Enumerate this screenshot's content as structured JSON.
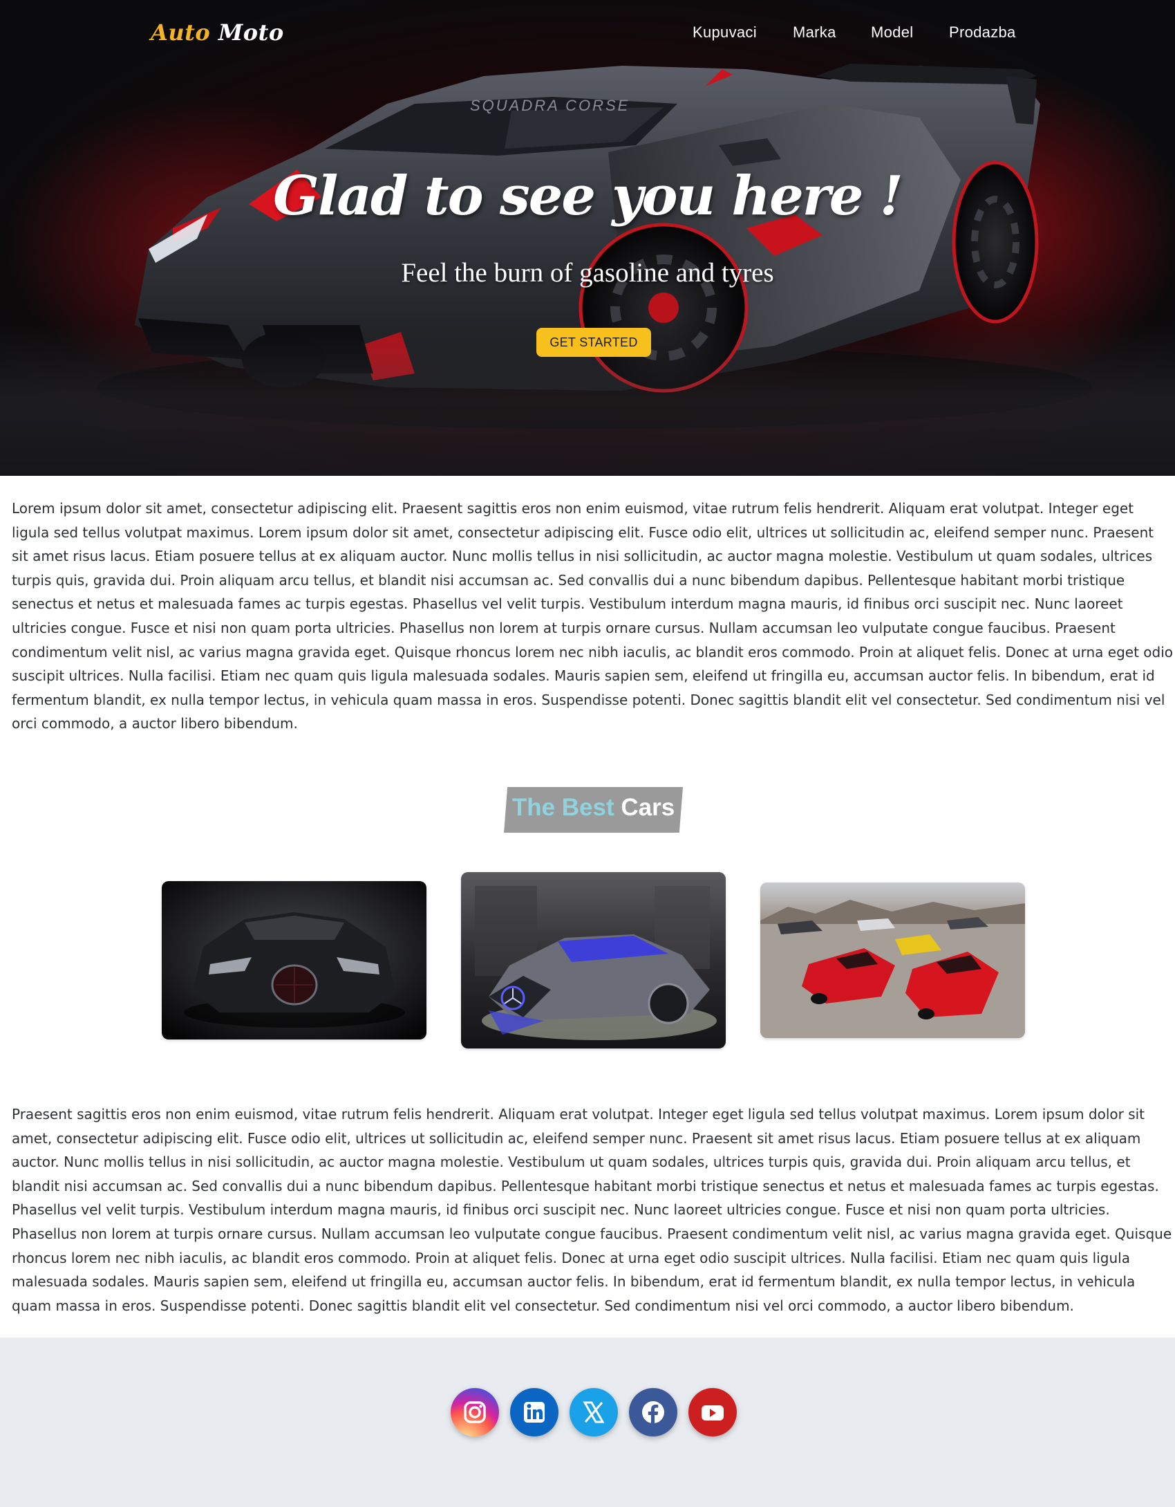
{
  "brand": {
    "part1": "Auto",
    "part2": "Moto"
  },
  "nav": {
    "items": [
      {
        "label": "Kupuvaci"
      },
      {
        "label": "Marka"
      },
      {
        "label": "Model"
      },
      {
        "label": "Prodazba"
      }
    ]
  },
  "hero": {
    "title": "Glad to see you here !",
    "subtitle": "Feel the burn of gasoline and tyres",
    "cta_label": "GET STARTED",
    "car_lettering": "SQUADRA CORSE"
  },
  "intro_text": "Lorem ipsum dolor sit amet, consectetur adipiscing elit. Praesent sagittis eros non enim euismod, vitae rutrum felis hendrerit. Aliquam erat volutpat. Integer eget ligula sed tellus volutpat maximus. Lorem ipsum dolor sit amet, consectetur adipiscing elit. Fusce odio elit, ultrices ut sollicitudin ac, eleifend semper nunc. Praesent sit amet risus lacus. Etiam posuere tellus at ex aliquam auctor. Nunc mollis tellus in nisi sollicitudin, ac auctor magna molestie. Vestibulum ut quam sodales, ultrices turpis quis, gravida dui. Proin aliquam arcu tellus, et blandit nisi accumsan ac. Sed convallis dui a nunc bibendum dapibus. Pellentesque habitant morbi tristique senectus et netus et malesuada fames ac turpis egestas. Phasellus vel velit turpis. Vestibulum interdum magna mauris, id finibus orci suscipit nec. Nunc laoreet ultricies congue. Fusce et nisi non quam porta ultricies. Phasellus non lorem at turpis ornare cursus. Nullam accumsan leo vulputate congue faucibus. Praesent condimentum velit nisl, ac varius magna gravida eget. Quisque rhoncus lorem nec nibh iaculis, ac blandit eros commodo. Proin at aliquet felis. Donec at urna eget odio suscipit ultrices. Nulla facilisi. Etiam nec quam quis ligula malesuada sodales. Mauris sapien sem, eleifend ut fringilla eu, accumsan auctor felis. In bibendum, erat id fermentum blandit, ex nulla tempor lectus, in vehicula quam massa in eros. Suspendisse potenti. Donec sagittis blandit elit vel consectetur. Sed condimentum nisi vel orci commodo, a auctor libero bibendum.",
  "best_cars": {
    "title_part1": "The Best",
    "title_part2": "Cars",
    "cards": [
      {
        "image": "black-bugatti-photo"
      },
      {
        "image": "mercedes-concept-photo"
      },
      {
        "image": "red-ferraris-photo"
      }
    ]
  },
  "outro_text": "Praesent sagittis eros non enim euismod, vitae rutrum felis hendrerit. Aliquam erat volutpat. Integer eget ligula sed tellus volutpat maximus. Lorem ipsum dolor sit amet, consectetur adipiscing elit. Fusce odio elit, ultrices ut sollicitudin ac, eleifend semper nunc. Praesent sit amet risus lacus. Etiam posuere tellus at ex aliquam auctor. Nunc mollis tellus in nisi sollicitudin, ac auctor magna molestie. Vestibulum ut quam sodales, ultrices turpis quis, gravida dui. Proin aliquam arcu tellus, et blandit nisi accumsan ac. Sed convallis dui a nunc bibendum dapibus. Pellentesque habitant morbi tristique senectus et netus et malesuada fames ac turpis egestas. Phasellus vel velit turpis. Vestibulum interdum magna mauris, id finibus orci suscipit nec. Nunc laoreet ultricies congue. Fusce et nisi non quam porta ultricies. Phasellus non lorem at turpis ornare cursus. Nullam accumsan leo vulputate congue faucibus. Praesent condimentum velit nisl, ac varius magna gravida eget. Quisque rhoncus lorem nec nibh iaculis, ac blandit eros commodo. Proin at aliquet felis. Donec at urna eget odio suscipit ultrices. Nulla facilisi. Etiam nec quam quis ligula malesuada sodales. Mauris sapien sem, eleifend ut fringilla eu, accumsan auctor felis. In bibendum, erat id fermentum blandit, ex nulla tempor lectus, in vehicula quam massa in eros. Suspendisse potenti. Donec sagittis blandit elit vel consectetur. Sed condimentum nisi vel orci commodo, a auctor libero bibendum.",
  "footer": {
    "social": [
      {
        "icon": "instagram-icon"
      },
      {
        "icon": "linkedin-icon"
      },
      {
        "icon": "x-icon"
      },
      {
        "icon": "facebook-icon"
      },
      {
        "icon": "youtube-icon"
      }
    ]
  },
  "colors": {
    "accent": "#f8c01c",
    "brand_gold": "#f4b324",
    "badge_gray": "#9a9a9a",
    "badge_teal": "#8fd3df",
    "footer_bg": "#e8ebef",
    "instagram": "#d6249f",
    "linkedin": "#0a66c2",
    "x": "#1da1f2",
    "facebook": "#3b5998",
    "youtube": "#cc1f1f"
  }
}
